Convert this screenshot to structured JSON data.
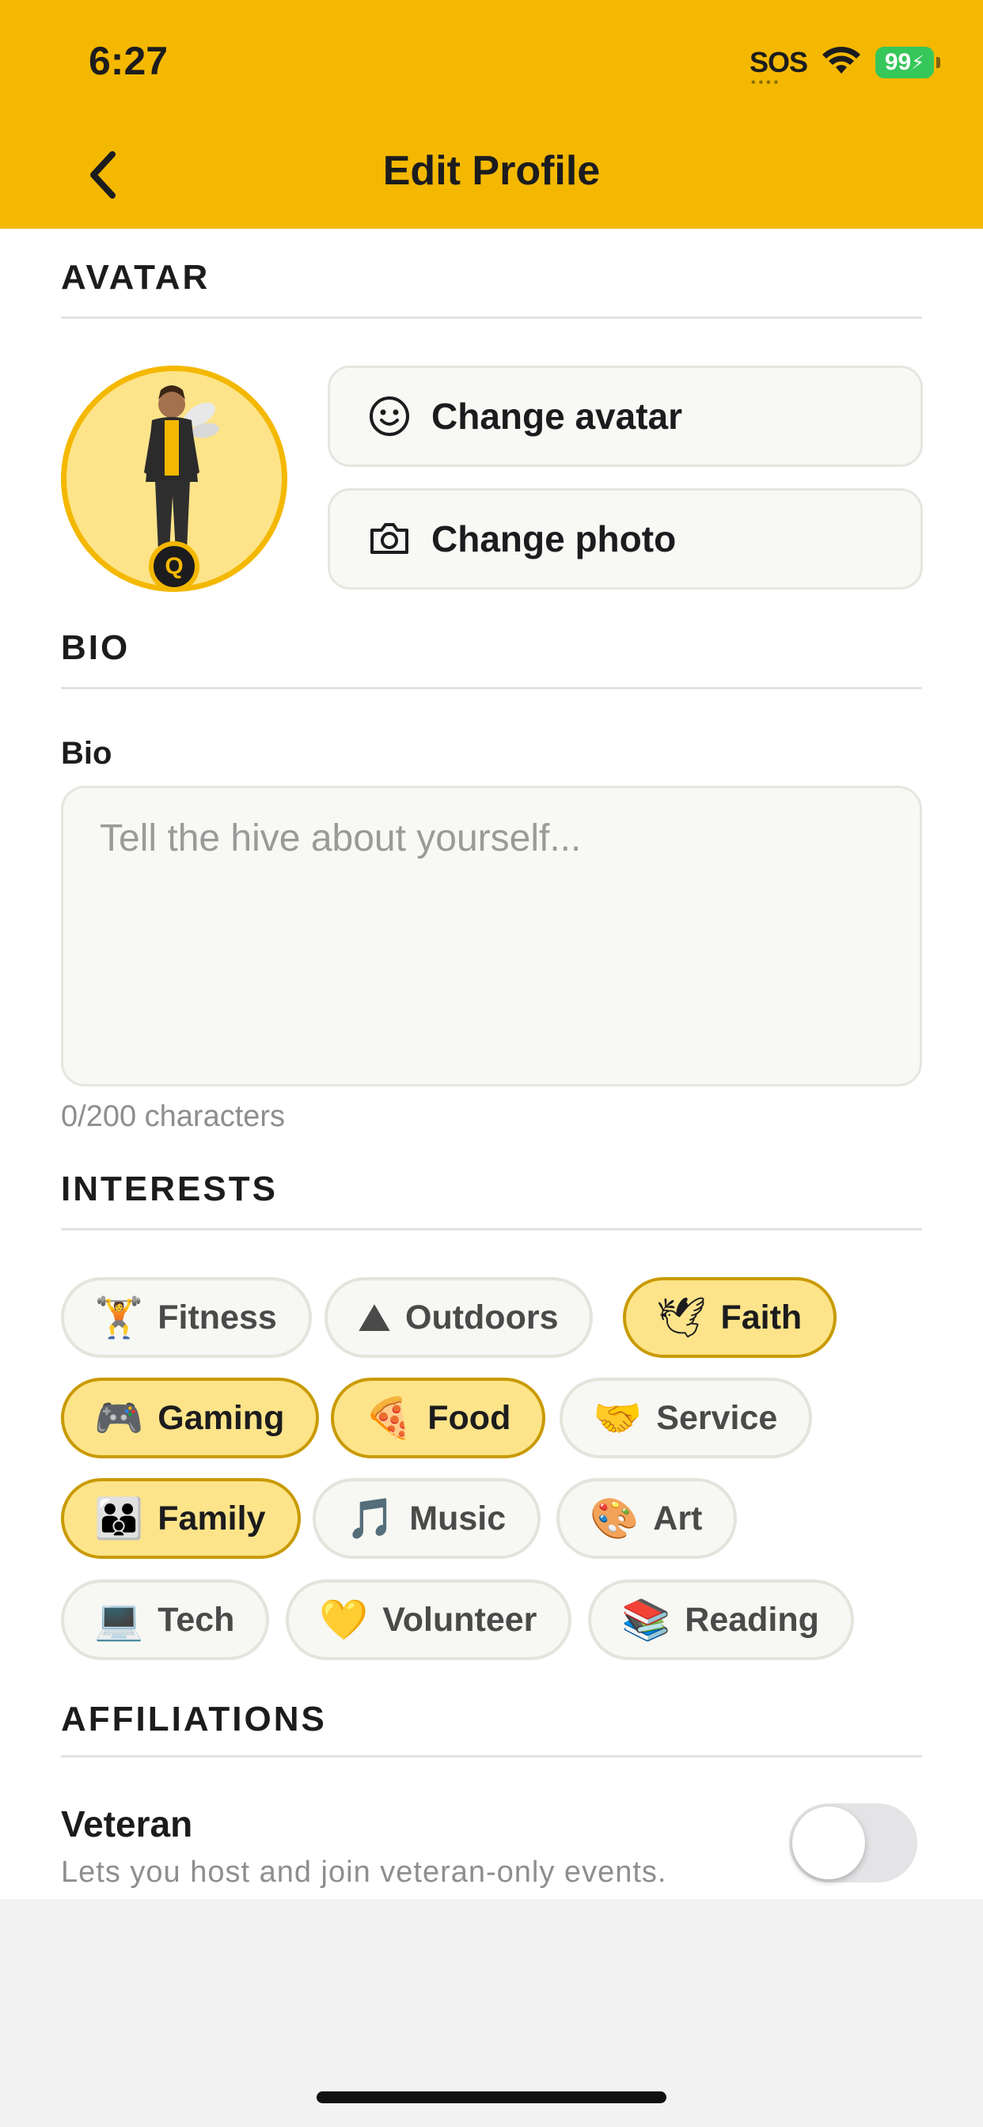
{
  "status_bar": {
    "time": "6:27",
    "sos": "SOS",
    "battery": "99"
  },
  "header": {
    "title": "Edit Profile",
    "back_icon": "chevron-left-icon"
  },
  "sections": {
    "avatar": "AVATAR",
    "bio": "BIO",
    "interests": "INTERESTS",
    "affiliations": "AFFILIATIONS"
  },
  "avatar": {
    "badge": "Q",
    "change_avatar": "Change avatar",
    "change_photo": "Change photo"
  },
  "bio": {
    "label": "Bio",
    "placeholder": "Tell the hive about yourself...",
    "value": "",
    "char_count": "0/200 characters"
  },
  "interests": [
    {
      "emoji": "🏋",
      "label": "Fitness",
      "selected": false
    },
    {
      "emoji": "⛰",
      "label": "Outdoors",
      "selected": false
    },
    {
      "emoji": "🕊",
      "label": "Faith",
      "selected": true
    },
    {
      "emoji": "🎮",
      "label": "Gaming",
      "selected": true
    },
    {
      "emoji": "🍕",
      "label": "Food",
      "selected": true
    },
    {
      "emoji": "🤝",
      "label": "Service",
      "selected": false
    },
    {
      "emoji": "👪",
      "label": "Family",
      "selected": true
    },
    {
      "emoji": "🎵",
      "label": "Music",
      "selected": false
    },
    {
      "emoji": "🎨",
      "label": "Art",
      "selected": false
    },
    {
      "emoji": "💻",
      "label": "Tech",
      "selected": false
    },
    {
      "emoji": "💛",
      "label": "Volunteer",
      "selected": false
    },
    {
      "emoji": "📚",
      "label": "Reading",
      "selected": false
    }
  ],
  "affiliations": {
    "veteran_title": "Veteran",
    "veteran_desc": "Lets you host and join veteran-only events.",
    "veteran_enabled": false
  },
  "colors": {
    "brand": "#f4b800",
    "chip_selected_bg": "#fde48a",
    "chip_selected_border": "#c99a00"
  }
}
